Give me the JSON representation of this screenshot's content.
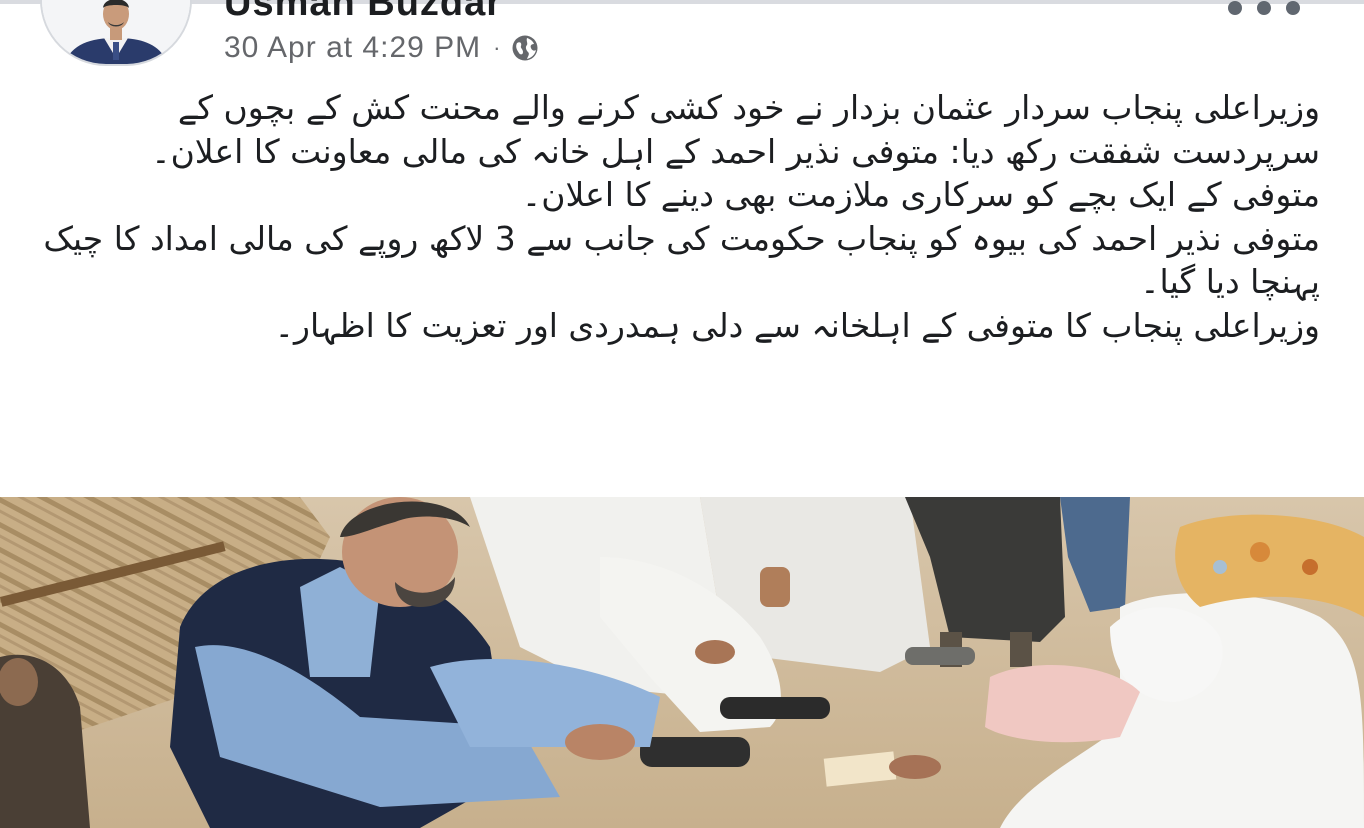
{
  "post": {
    "author_name": "Usman Buzdar",
    "timestamp": "30 Apr at 4:29 PM",
    "separator": "·",
    "audience_icon": "globe-icon",
    "more_icon": "more-options-icon",
    "text_paragraphs": [
      "وزیراعلی پنجاب سردار عثمان بزدار نے خود کشی کرنے والے محنت کش کے بچوں کے سرپردست شفقت رکھ دیا: متوفی نذیر احمد کے اہل خانہ کی مالی معاونت کا اعلان۔",
      "متوفی کے ایک بچے کو سرکاری ملازمت بھی دینے کا اعلان۔",
      "متوفی نذیر احمد کی بیوہ کو پنجاب حکومت کی جانب سے 3 لاکھ روپے کی مالی امداد کا چیک پہنچا دیا گیا۔",
      "وزیراعلی پنجاب کا متوفی کے اہلخانہ سے دلی ہمدردی اور تعزیت کا اظہار۔"
    ]
  },
  "colors": {
    "text_primary": "#1c1e21",
    "text_secondary": "#65676b",
    "background": "#ffffff"
  }
}
